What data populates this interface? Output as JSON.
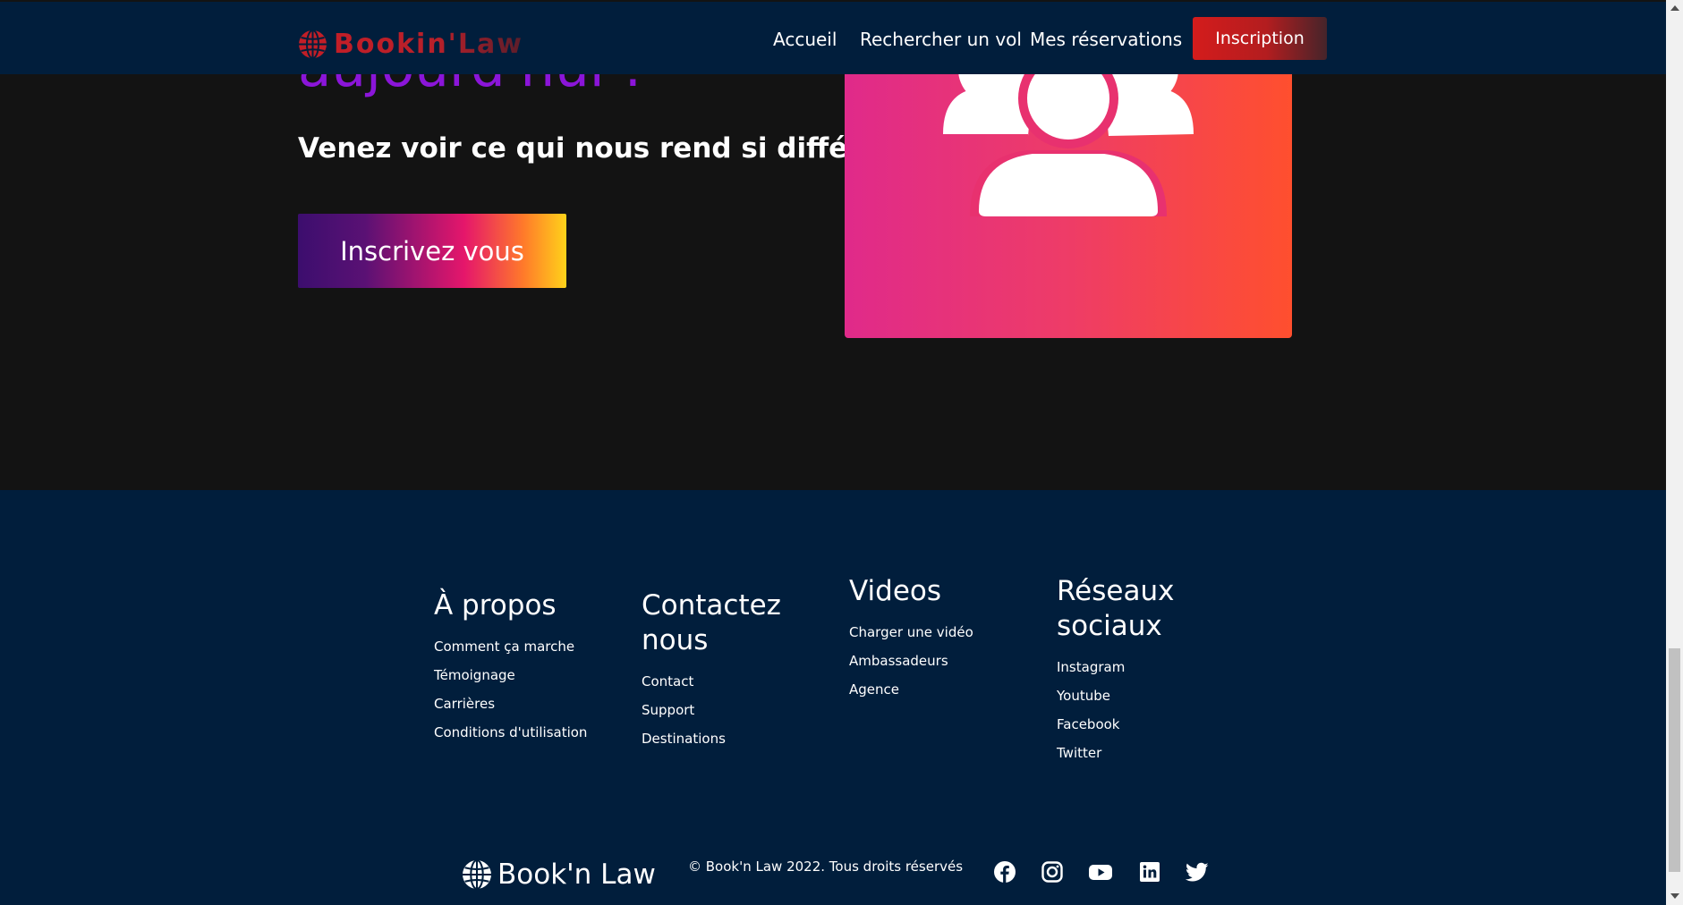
{
  "navbar": {
    "brand": "Bookin'Law",
    "links": [
      "Accueil",
      "Rechercher un vol",
      "Mes réservations"
    ],
    "signup_label": "Inscription"
  },
  "hero": {
    "title": "aujourd'hui !",
    "subtitle": "Venez voir ce qui nous rend si différent",
    "cta_label": "Inscrivez vous",
    "card_icon": "users-group-icon"
  },
  "footer": {
    "columns": [
      {
        "title": "À propos",
        "links": [
          "Comment ça marche",
          "Témoignage",
          "Carrières",
          "Conditions d'utilisation"
        ]
      },
      {
        "title": "Contactez nous",
        "links": [
          "Contact",
          "Support",
          "Destinations"
        ]
      },
      {
        "title": "Videos",
        "links": [
          "Charger une vidéo",
          "Ambassadeurs",
          "Agence"
        ]
      },
      {
        "title": "Réseaux sociaux",
        "links": [
          "Instagram",
          "Youtube",
          "Facebook",
          "Twitter"
        ]
      }
    ],
    "brand": "Book'n Law",
    "copyright": "© Book'n Law 2022. Tous droits réservés",
    "social_icons": [
      "facebook-icon",
      "instagram-icon",
      "youtube-icon",
      "linkedin-icon",
      "twitter-icon"
    ]
  },
  "colors": {
    "navbar_bg": "#011e3c",
    "page_bg": "#131313",
    "hero_title": "#8b15d9",
    "brand_red": "#c21e27",
    "card_gradient": [
      "#e02a8a",
      "#ff4f2e"
    ]
  }
}
